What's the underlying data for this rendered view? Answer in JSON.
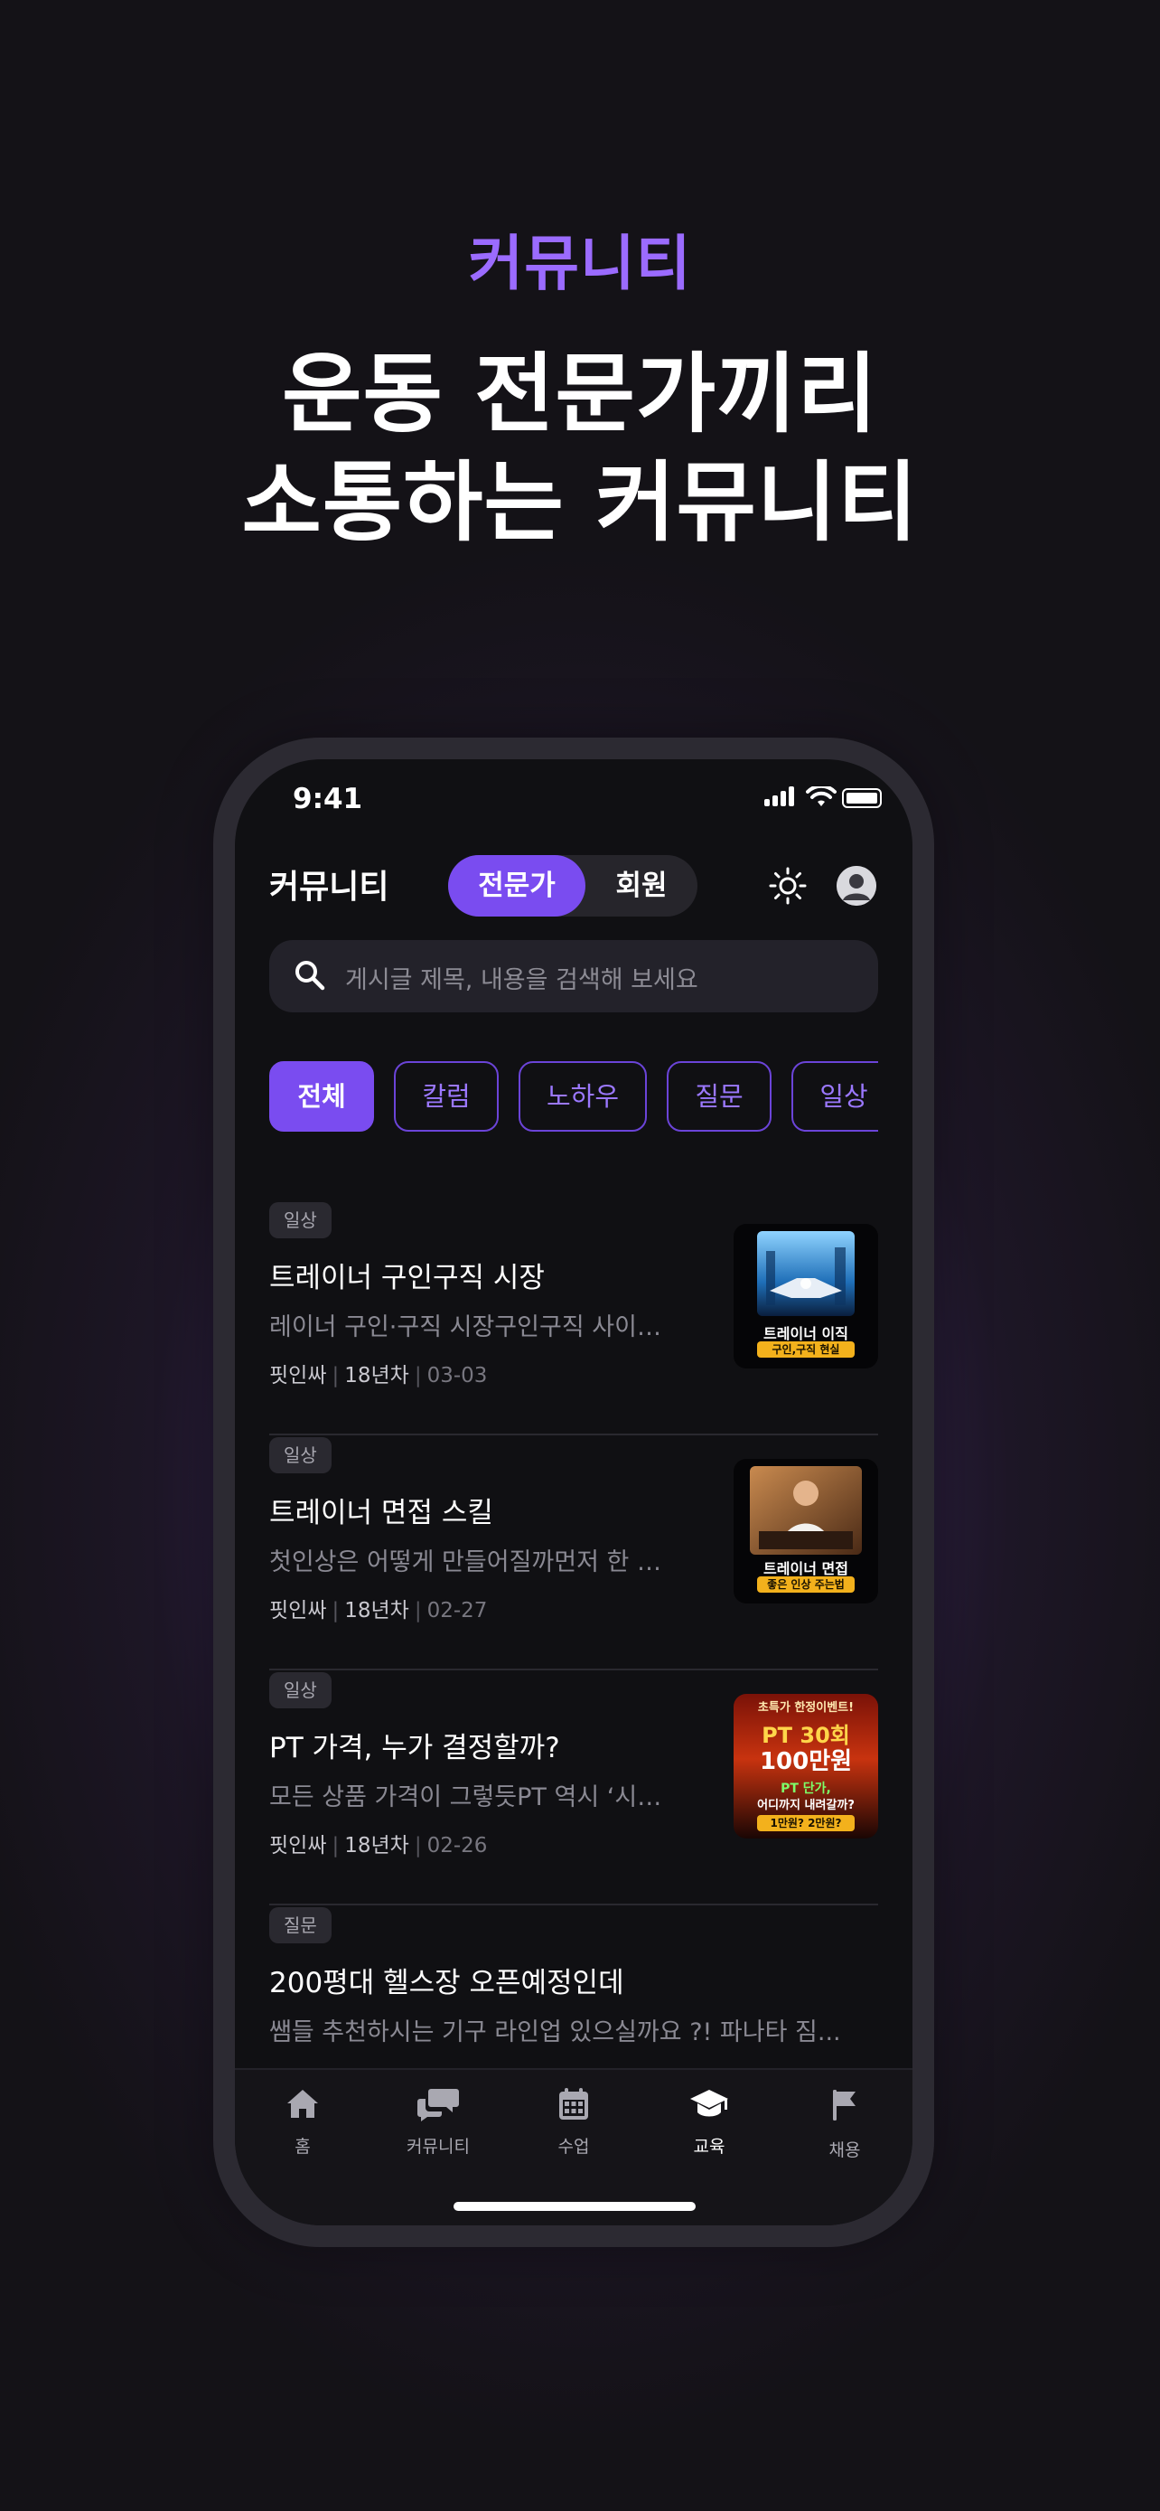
{
  "hero": {
    "eyebrow": "커뮤니티",
    "line1": "운동 전문가끼리",
    "line2": "소통하는 커뮤니티"
  },
  "status_bar": {
    "time": "9:41"
  },
  "header": {
    "title": "커뮤니티",
    "segment": {
      "active": "전문가",
      "inactive": "회원"
    },
    "theme_icon": "sun-icon",
    "profile_icon": "avatar-icon"
  },
  "search": {
    "placeholder": "게시글 제목, 내용을 검색해 보세요"
  },
  "categories": [
    "전체",
    "칼럼",
    "노하우",
    "질문",
    "일상"
  ],
  "posts": [
    {
      "tag": "일상",
      "title": "트레이너 구인구직 시장",
      "excerpt": "레이너 구인·구직 시장구인구직 사이트...",
      "author": "핏인싸",
      "experience": "18년차",
      "date": "03-03",
      "thumb_title": "트레이너 이직",
      "thumb_sub": "구인,구직 현실"
    },
    {
      "tag": "일상",
      "title": "트레이너 면접 스킬",
      "excerpt": "첫인상은 어떻게 만들어질까먼저 한 가...",
      "author": "핏인싸",
      "experience": "18년차",
      "date": "02-27",
      "thumb_title": "트레이너 면접",
      "thumb_sub": "좋은 인상 주는법"
    },
    {
      "tag": "일상",
      "title": "PT 가격, 누가 결정할까?",
      "excerpt": "모든 상품 가격이 그렇듯PT 역시 ‘시장...",
      "author": "핏인싸",
      "experience": "18년차",
      "date": "02-26",
      "thumb_top": "초특가 한정이벤트!",
      "thumb_big1": "PT 30회",
      "thumb_big2": "100만원",
      "thumb_q1": "PT 단가,",
      "thumb_q2": "어디까지 내려갈까?",
      "thumb_q3": "1만원? 2만원?"
    },
    {
      "tag": "질문",
      "title": "200평대 헬스장 오픈예정인데",
      "excerpt": "쌤들 추천하시는 기구 라인업 있으실까요 ?! 파나타 짐..."
    }
  ],
  "tabs": [
    {
      "label": "홈",
      "icon": "home-icon"
    },
    {
      "label": "커뮤니티",
      "icon": "chat-icon"
    },
    {
      "label": "수업",
      "icon": "calendar-icon"
    },
    {
      "label": "교육",
      "icon": "graduation-cap-icon"
    },
    {
      "label": "채용",
      "icon": "flag-icon"
    }
  ],
  "colors": {
    "accent": "#7a4cf0",
    "accent_text": "#9b6bff",
    "screen_bg": "#101013"
  }
}
